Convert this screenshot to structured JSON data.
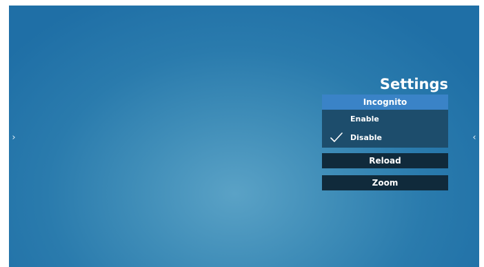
{
  "screen": {
    "background_color": "#2a7bad"
  },
  "nav": {
    "left_icon": "chevron-right-icon",
    "left_glyph": "›",
    "right_icon": "chevron-left-icon",
    "right_glyph": "‹"
  },
  "settings": {
    "title": "Settings",
    "incognito": {
      "header": "Incognito",
      "options": [
        {
          "label": "Enable",
          "selected": false
        },
        {
          "label": "Disable",
          "selected": true
        }
      ]
    },
    "reload_label": "Reload",
    "zoom_label": "Zoom"
  },
  "colors": {
    "header_accent": "#3a83c7",
    "options_bg": "#1d4d6c",
    "button_bg": "#102a3b",
    "text": "#ffffff"
  }
}
